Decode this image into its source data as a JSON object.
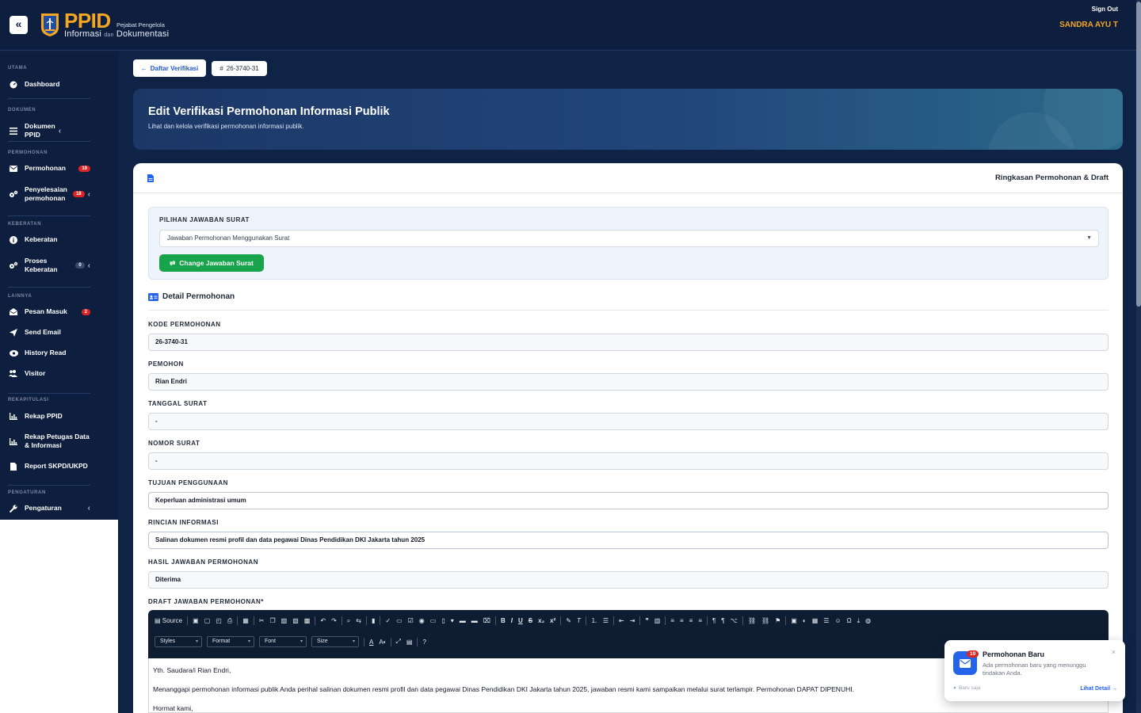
{
  "header": {
    "logo_text": "PPID",
    "logo_sub1": "Pejabat Pengelola",
    "logo_sub2a": "Informasi",
    "logo_sub2b": "dan",
    "logo_sub2c": "Dokumentasi",
    "signout": "Sign Out",
    "username": "SANDRA AYU T"
  },
  "sidebar": {
    "sections": {
      "utama": "UTAMA",
      "dokumen": "DOKUMEN",
      "permohonan": "PERMOHONAN",
      "keberatan": "KEBERATAN",
      "lainnya": "LAINNYA",
      "rekapitulasi": "REKAPITULASI",
      "pengaturan": "PENGATURAN"
    },
    "items": {
      "dashboard": "Dashboard",
      "dokumen_ppid": "Dokumen PPID",
      "permohonan": "Permohonan",
      "permohonan_badge": "19",
      "penyelesaian": "Penyelesaian permohonan",
      "penyelesaian_badge": "18",
      "keberatan": "Keberatan",
      "proses_keberatan": "Proses Keberatan",
      "proses_keberatan_badge": "0",
      "pesan_masuk": "Pesan Masuk",
      "pesan_masuk_badge": "2",
      "send_email": "Send Email",
      "history_read": "History Read",
      "visitor": "Visitor",
      "rekap_ppid": "Rekap PPID",
      "rekap_petugas": "Rekap Petugas Data & Informasi",
      "report_skpd": "Report SKPD/UKPD",
      "pengaturan": "Pengaturan"
    }
  },
  "breadcrumb": {
    "back_label": "Daftar Verifikasi",
    "code_label": "26-3740-31"
  },
  "hero": {
    "title": "Edit Verifikasi Permohonan Informasi Publik",
    "subtitle": "Lihat dan kelola verifikasi permohonan informasi publik."
  },
  "card": {
    "title": "Ringkasan Permohonan & Draft",
    "choice_label": "PILIHAN JAWABAN SURAT",
    "choice_value": "Jawaban Permohonan Menggunakan Surat",
    "change_button": "Change Jawaban Surat",
    "detail_title": "Detail Permohonan"
  },
  "fields": {
    "kode_label": "KODE PERMOHONAN",
    "kode_value": "26-3740-31",
    "pemohon_label": "PEMOHON",
    "pemohon_value": "Rian Endri",
    "tanggal_label": "TANGGAL SURAT",
    "tanggal_value": "-",
    "nomor_label": "NOMOR SURAT",
    "nomor_value": "-",
    "tujuan_label": "TUJUAN PENGGUNAAN",
    "tujuan_value": "Keperluan administrasi umum",
    "rincian_label": "RINCIAN INFORMASI",
    "rincian_value": "Salinan dokumen resmi profil dan data pegawai Dinas Pendidikan DKI Jakarta tahun 2025",
    "hasil_label": "HASIL JAWABAN PERMOHONAN",
    "hasil_value": "Diterima",
    "draft_label": "DRAFT JAWABAN PERMOHONAN*"
  },
  "editor": {
    "source_label": "Source",
    "styles": "Styles",
    "format": "Format",
    "font": "Font",
    "size": "Size",
    "line1_prefix": "Yth. Saudara/i",
    "line1_name": "Rian Endri",
    "line1_suffix": ",",
    "line2": "Menanggapi permohonan informasi publik Anda perihal salinan dokumen resmi profil dan data pegawai Dinas Pendidikan DKI Jakarta tahun 2025, jawaban resmi kami sampaikan melalui surat terlampir. Permohonan DAPAT DIPENUHI.",
    "line3": "Hormat kami,"
  },
  "toast": {
    "badge": "19",
    "title": "Permohonan Baru",
    "body": "Ada permohonan baru yang menunggu tindakan Anda.",
    "time": "Baru saja",
    "link": "Lihat Detail →"
  },
  "colors": {
    "navy": "#0d1e3e",
    "accent": "#f5a623",
    "primary": "#2457c5",
    "success": "#16a34a",
    "danger": "#dc2626"
  }
}
